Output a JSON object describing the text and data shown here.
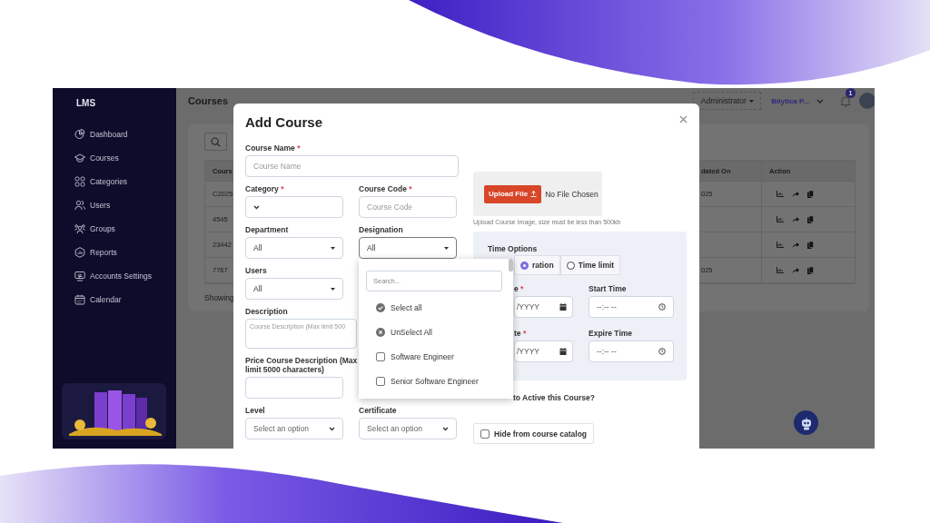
{
  "sidebar": {
    "logo": "LMS",
    "items": [
      {
        "label": "Dashboard",
        "selected": false
      },
      {
        "label": "Courses",
        "selected": false
      },
      {
        "label": "Categories",
        "selected": false
      },
      {
        "label": "Users",
        "selected": false
      },
      {
        "label": "Groups",
        "selected": false
      },
      {
        "label": "Reports",
        "selected": false
      },
      {
        "label": "Accounts Settings",
        "selected": false
      },
      {
        "label": "Calendar",
        "selected": false
      }
    ]
  },
  "topbar": {
    "title": "Courses",
    "role": "Administrator",
    "user": "Bilytica P...",
    "notification_count": "1"
  },
  "courses_table": {
    "columns": [
      "Cours",
      "dated On",
      "Action"
    ],
    "rows": [
      {
        "column_1": "C2025",
        "column_2": "025"
      },
      {
        "column_1": "4545"
      },
      {
        "column_1": "23442"
      },
      {
        "column_1": "7767",
        "column_2": "025"
      }
    ],
    "footer": "Showing"
  },
  "add_course": {
    "title": "Add Course",
    "rows": [
      [
        {
          "kind": "input",
          "label": "Course Name",
          "mark": "*",
          "placeholder": "Course Name"
        }
      ],
      [
        {
          "kind": "select",
          "label": "Category",
          "mark": "*"
        },
        {
          "kind": "input",
          "label": "Course Code",
          "mark": "*",
          "placeholder": "Course Code"
        }
      ],
      [
        {
          "kind": "multiselect",
          "label": "Department",
          "value": "All",
          "open": false
        },
        {
          "kind": "multiselect",
          "label": "Designation",
          "value": "All",
          "open": true
        }
      ],
      [
        {
          "kind": "multiselect",
          "label": "Users",
          "value": "All",
          "open": false
        }
      ],
      [
        {
          "kind": "textarea",
          "label": "Description",
          "placeholder": "Course Description (Max limit 500"
        }
      ],
      [
        {
          "kind": "input",
          "label": "Price Course Description (Max limit 5000 characters)"
        }
      ],
      [
        {
          "kind": "select",
          "label": "Level",
          "placeholder": "Select an option"
        },
        {
          "kind": "select",
          "label": "Certificate",
          "placeholder": "Select an option"
        }
      ]
    ],
    "designation_menu": {
      "search_placeholder": "Search...",
      "actions": [
        {
          "kind": "select_all",
          "label": "Select all"
        },
        {
          "kind": "unselect_all",
          "label": "UnSelect All"
        }
      ],
      "options": [
        {
          "label": "Software Engineer",
          "checked": false
        },
        {
          "label": "Senior Software Engineer",
          "checked": false
        }
      ]
    },
    "upload": {
      "button": "Upload File",
      "status": "No File Chosen",
      "hint": "Upload Course Image, size must be less than 500kb"
    },
    "time_options": {
      "title": "Time Options",
      "modes": [
        {
          "label": "ration",
          "selected": true
        },
        {
          "label": "Time limit",
          "selected": false
        }
      ],
      "fields": [
        {
          "kind": "date",
          "label": "e",
          "mark": "*",
          "value": "/YYYY"
        },
        {
          "kind": "time",
          "label": "Start Time",
          "value": "--:-- --"
        },
        {
          "kind": "date",
          "label": "te",
          "mark": "*",
          "value": "/YYYY"
        },
        {
          "kind": "time",
          "label": "Expire Time",
          "value": "--:-- --"
        }
      ]
    },
    "active_question": "to Active this Course?",
    "hide_from_catalog": {
      "label": "Hide from course catalog",
      "checked": false
    }
  }
}
